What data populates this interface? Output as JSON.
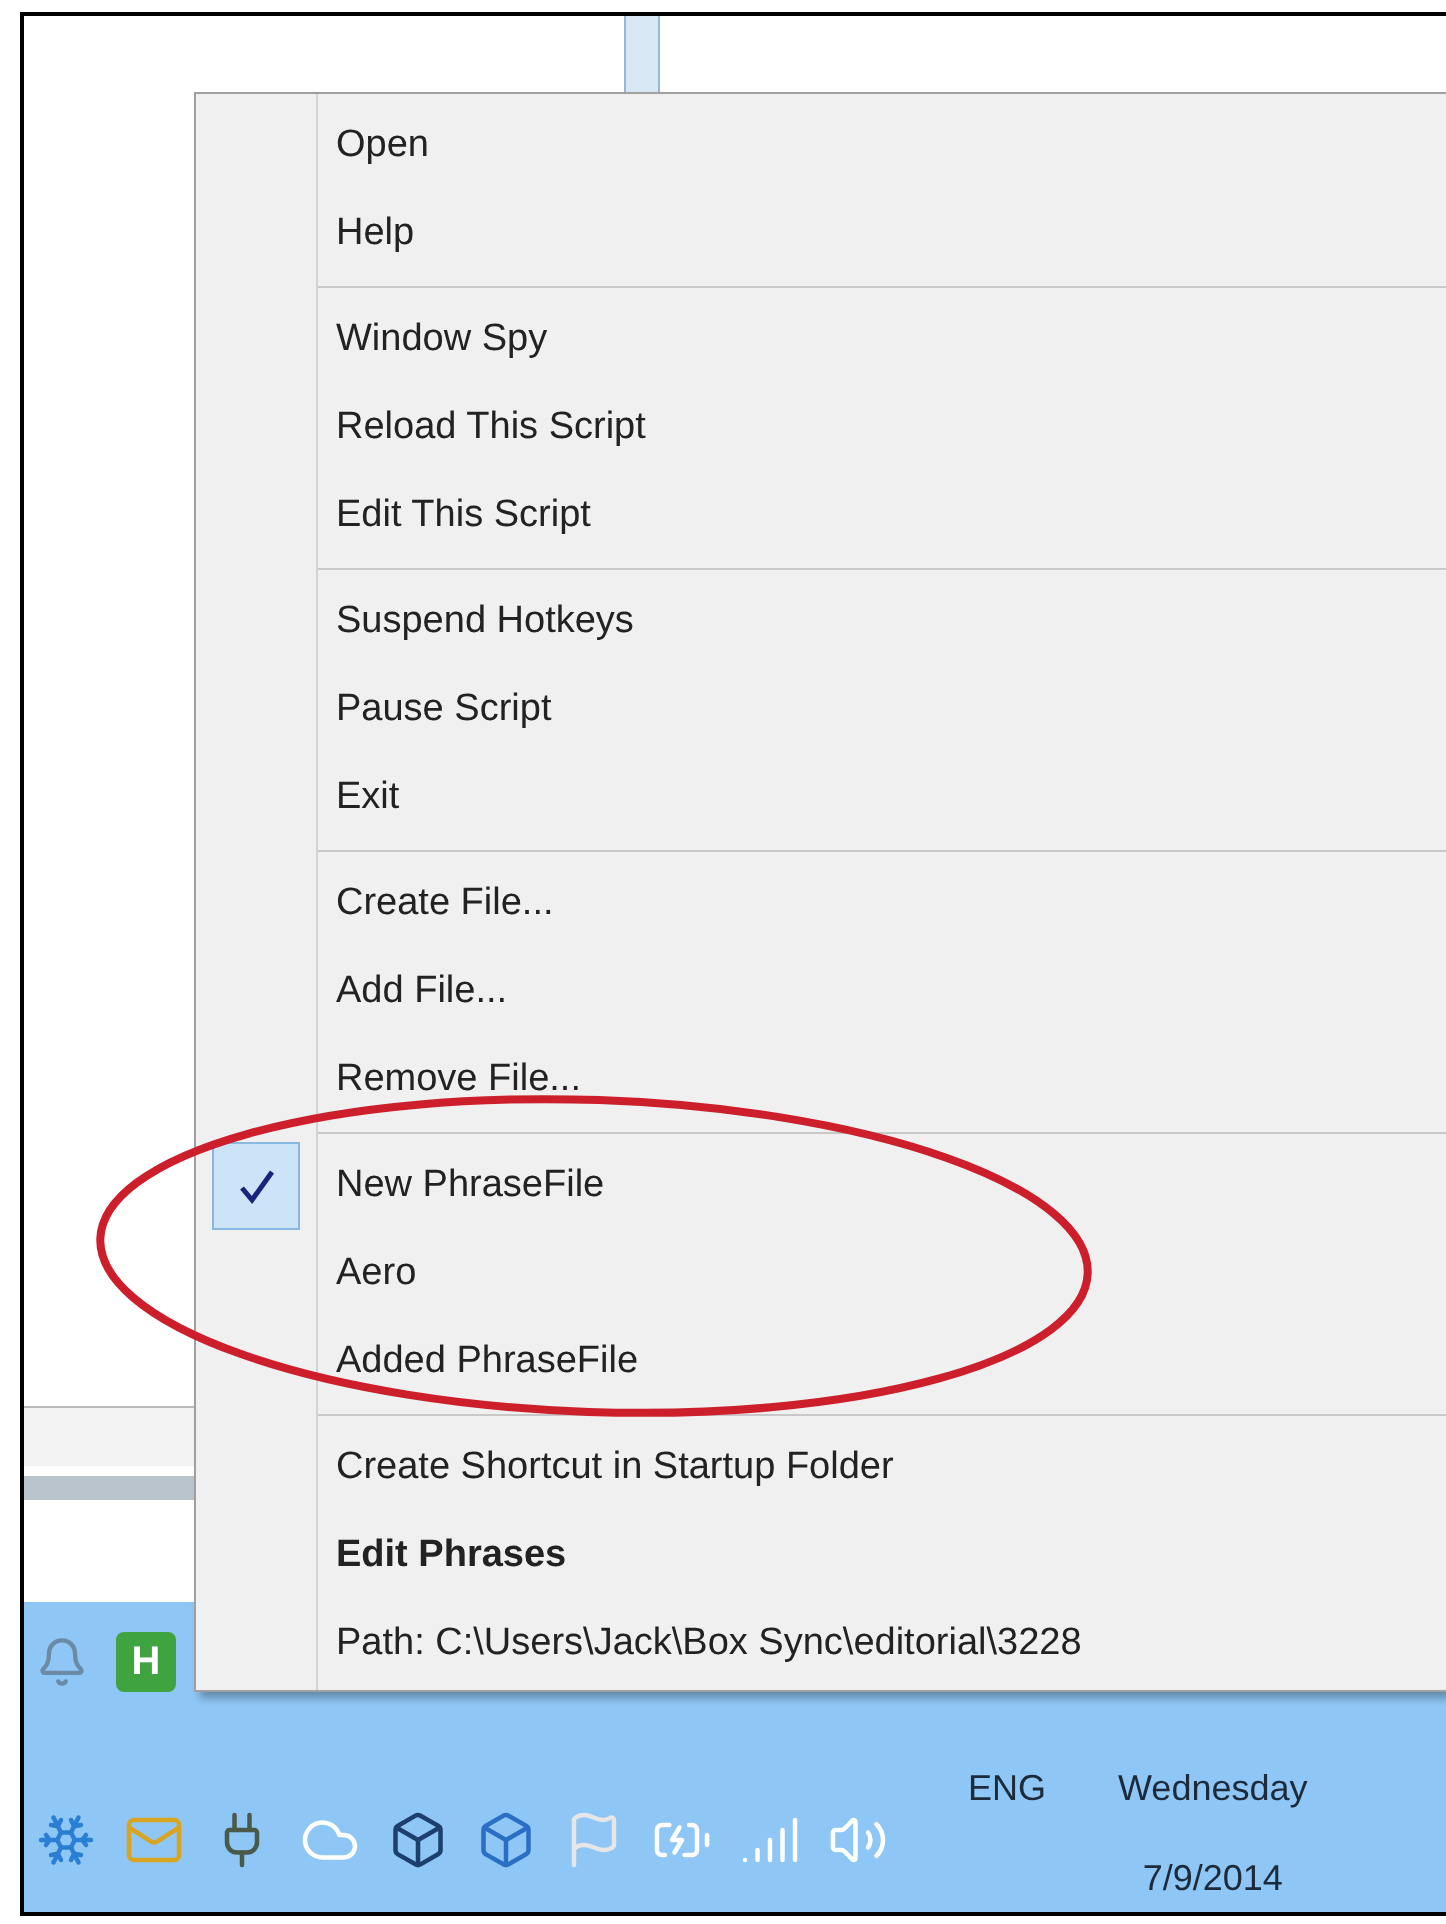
{
  "menu": {
    "groups": [
      {
        "items": [
          {
            "label": "Open",
            "kind": "normal",
            "checked": false
          },
          {
            "label": "Help",
            "kind": "normal",
            "checked": false
          }
        ]
      },
      {
        "items": [
          {
            "label": "Window Spy",
            "kind": "normal",
            "checked": false
          },
          {
            "label": "Reload This Script",
            "kind": "normal",
            "checked": false
          },
          {
            "label": "Edit This Script",
            "kind": "normal",
            "checked": false
          }
        ]
      },
      {
        "items": [
          {
            "label": "Suspend Hotkeys",
            "kind": "normal",
            "checked": false
          },
          {
            "label": "Pause Script",
            "kind": "normal",
            "checked": false
          },
          {
            "label": "Exit",
            "kind": "normal",
            "checked": false
          }
        ]
      },
      {
        "items": [
          {
            "label": "Create File...",
            "kind": "normal",
            "checked": false
          },
          {
            "label": "Add File...",
            "kind": "normal",
            "checked": false
          },
          {
            "label": "Remove File...",
            "kind": "normal",
            "checked": false
          }
        ]
      },
      {
        "items": [
          {
            "label": "New PhraseFile",
            "kind": "normal",
            "checked": true
          },
          {
            "label": "Aero",
            "kind": "normal",
            "checked": false
          },
          {
            "label": "Added PhraseFile",
            "kind": "normal",
            "checked": false
          }
        ]
      },
      {
        "items": [
          {
            "label": "Create Shortcut in Startup Folder",
            "kind": "normal",
            "checked": false
          },
          {
            "label": "Edit Phrases",
            "kind": "bold",
            "checked": false
          },
          {
            "label": "Path: C:\\Users\\Jack\\Box Sync\\editorial\\3228",
            "kind": "normal",
            "checked": false
          }
        ]
      }
    ]
  },
  "taskbar": {
    "app_letter": "H",
    "language": "ENG",
    "day": "Wednesday",
    "date": "7/9/2014"
  }
}
